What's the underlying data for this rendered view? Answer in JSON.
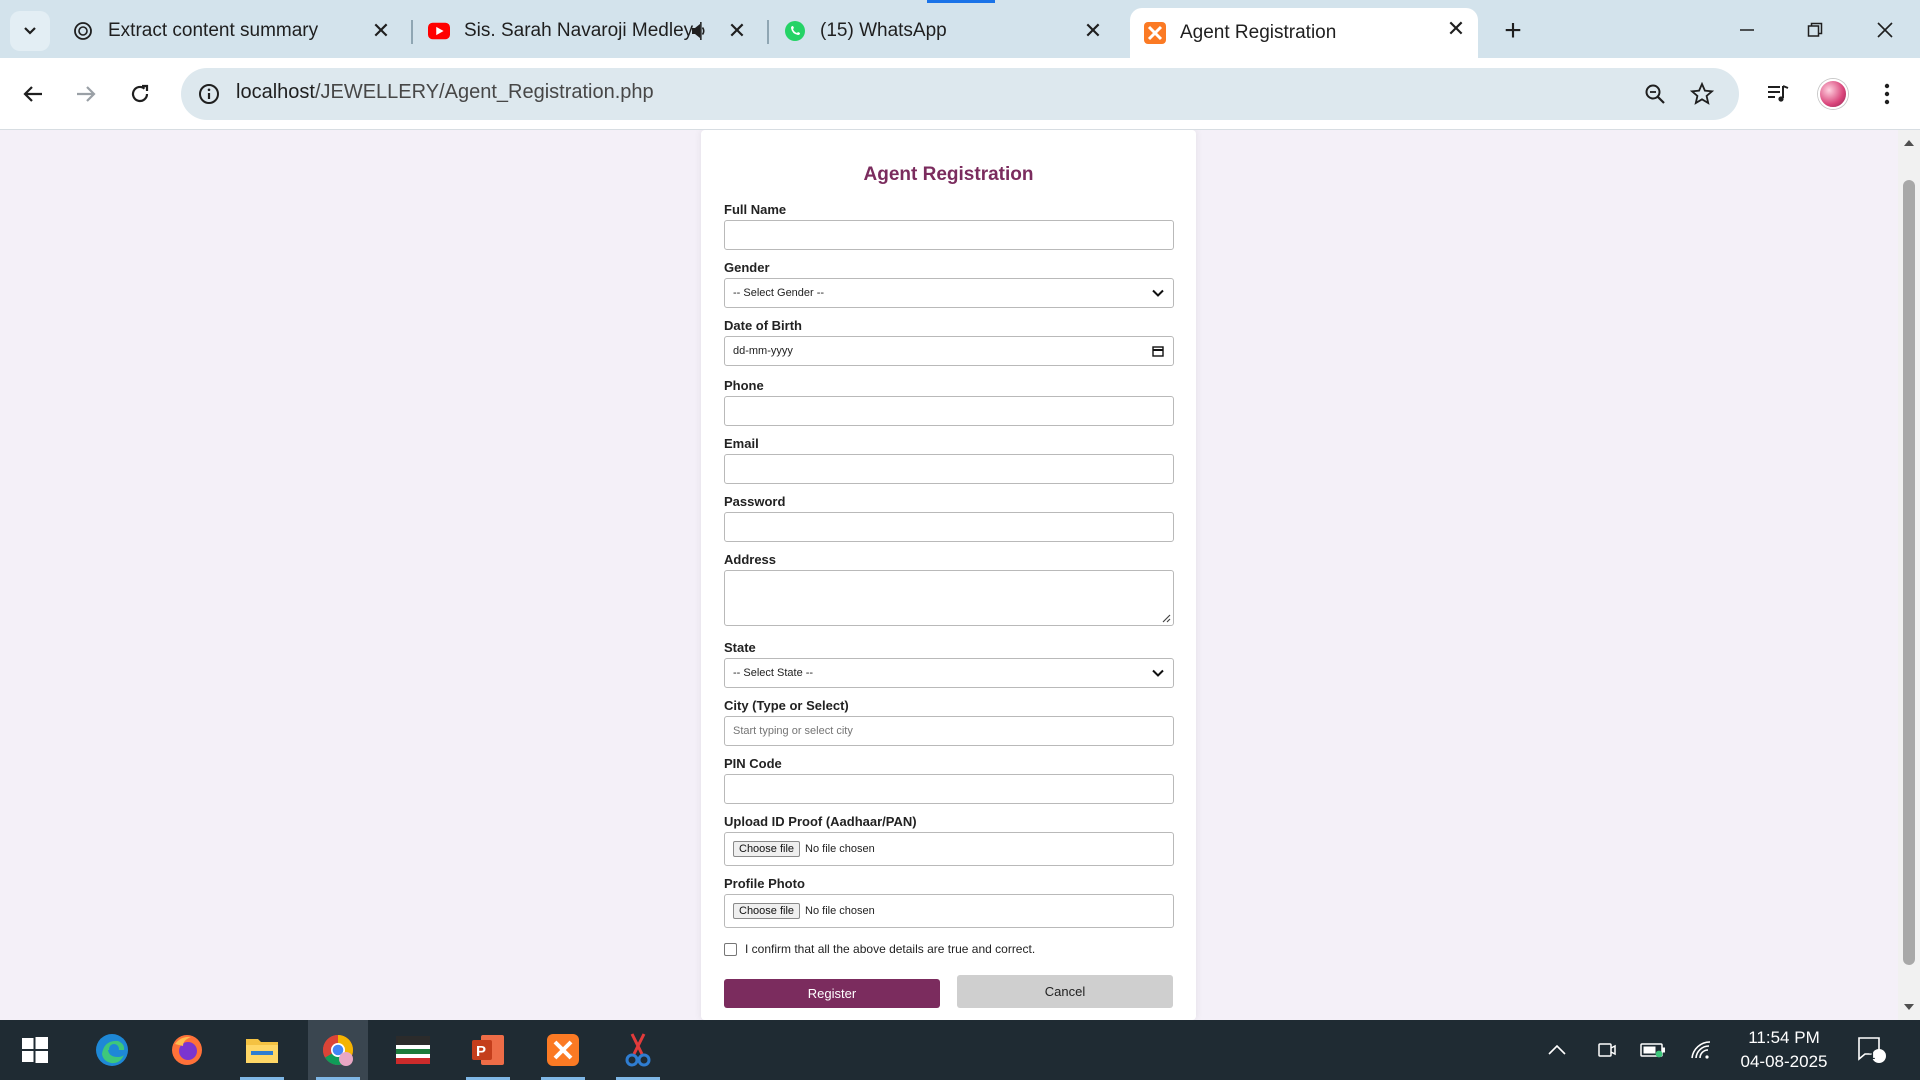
{
  "browser": {
    "tabs": [
      {
        "title": "Extract content summary",
        "icon": "chatgpt-icon"
      },
      {
        "title": "Sis. Sarah Navaroji Medley |",
        "icon": "youtube-icon",
        "audio": true
      },
      {
        "title": "(15) WhatsApp",
        "icon": "whatsapp-icon"
      },
      {
        "title": "Agent Registration",
        "icon": "xampp-icon",
        "active": true
      }
    ],
    "url_host": "localhost",
    "url_path": "/JEWELLERY/Agent_Registration.php"
  },
  "form": {
    "title": "Agent Registration",
    "full_name_label": "Full Name",
    "gender_label": "Gender",
    "gender_selected": "-- Select Gender --",
    "dob_label": "Date of Birth",
    "dob_placeholder": "dd-mm-yyyy",
    "phone_label": "Phone",
    "email_label": "Email",
    "password_label": "Password",
    "address_label": "Address",
    "state_label": "State",
    "state_selected": "-- Select State --",
    "city_label": "City (Type or Select)",
    "city_placeholder": "Start typing or select city",
    "pin_label": "PIN Code",
    "id_proof_label": "Upload ID Proof (Aadhaar/PAN)",
    "profile_photo_label": "Profile Photo",
    "choose_file": "Choose file",
    "no_file": "No file chosen",
    "confirm_text": "I confirm that all the above details are true and correct.",
    "register_label": "Register",
    "cancel_label": "Cancel"
  },
  "taskbar": {
    "time": "11:54 PM",
    "date": "04-08-2025",
    "notification_count": "1",
    "apps": [
      "windows-start-icon",
      "edge-icon",
      "firefox-icon",
      "file-explorer-icon",
      "chrome-icon",
      "media-app-icon",
      "powerpoint-icon",
      "xampp-icon",
      "snipping-tool-icon"
    ]
  },
  "colors": {
    "accent": "#7b2c5e",
    "page_bg": "#f4f0f8",
    "tabstrip_bg": "#d3e3ec",
    "taskbar_bg": "#1f2b33"
  }
}
